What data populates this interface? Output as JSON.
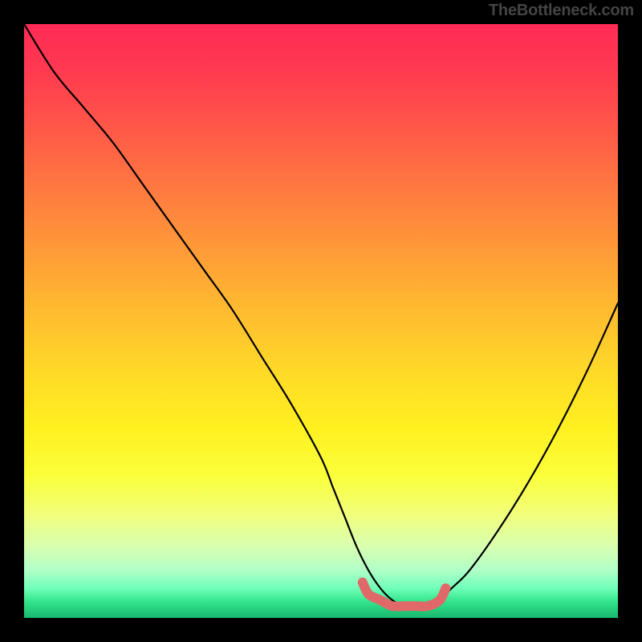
{
  "watermark": "TheBottleneck.com",
  "chart_data": {
    "type": "line",
    "title": "",
    "xlabel": "",
    "ylabel": "",
    "xlim": [
      0,
      100
    ],
    "ylim": [
      0,
      100
    ],
    "series": [
      {
        "name": "bottleneck-curve",
        "x": [
          0,
          5,
          10,
          15,
          20,
          25,
          30,
          35,
          40,
          45,
          50,
          52,
          54,
          56,
          58,
          60,
          62,
          64,
          66,
          68,
          70,
          72,
          75,
          80,
          85,
          90,
          95,
          100
        ],
        "values": [
          100,
          92,
          86,
          80,
          73,
          66,
          59,
          52,
          44,
          36,
          27,
          22,
          17,
          12,
          8,
          5,
          3,
          2,
          2,
          2,
          3,
          5,
          8,
          15,
          23,
          32,
          42,
          53
        ]
      },
      {
        "name": "optimal-marker",
        "x": [
          57,
          58,
          60,
          62,
          64,
          66,
          68,
          70,
          71
        ],
        "values": [
          6,
          4,
          3,
          2,
          2,
          2,
          2,
          3,
          5
        ]
      }
    ],
    "gradient_stops": [
      {
        "pct": 0,
        "color": "#ff2a55"
      },
      {
        "pct": 50,
        "color": "#ffd828"
      },
      {
        "pct": 100,
        "color": "#18b870"
      }
    ]
  }
}
